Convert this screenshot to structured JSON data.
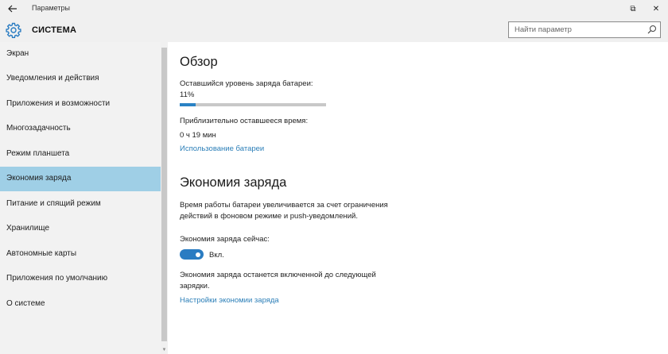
{
  "window": {
    "title": "Параметры",
    "restore_glyph": "⧉",
    "close_glyph": "✕"
  },
  "header": {
    "title": "СИСТЕМА",
    "search_placeholder": "Найти параметр"
  },
  "sidebar": {
    "selected_index": 5,
    "items": [
      {
        "label": "Экран"
      },
      {
        "label": "Уведомления и действия"
      },
      {
        "label": "Приложения и возможности"
      },
      {
        "label": "Многозадачность"
      },
      {
        "label": "Режим планшета"
      },
      {
        "label": "Экономия заряда"
      },
      {
        "label": "Питание и спящий режим"
      },
      {
        "label": "Хранилище"
      },
      {
        "label": "Автономные карты"
      },
      {
        "label": "Приложения по умолчанию"
      },
      {
        "label": "О системе"
      }
    ]
  },
  "overview": {
    "heading": "Обзор",
    "battery_label": "Оставшийся уровень заряда батареи:",
    "battery_value": "11%",
    "battery_fraction": 0.11,
    "time_label": "Приблизительно оставшееся время:",
    "time_value": "0 ч 19 мин",
    "usage_link": "Использование батареи"
  },
  "saver": {
    "heading": "Экономия заряда",
    "description_line1": "Время работы батареи увеличивается за счет ограничения",
    "description_line2": "действий в фоновом режиме и push-уведомлений.",
    "now_label": "Экономия заряда сейчас:",
    "toggle_state": "Вкл.",
    "note_line1": "Экономия заряда останется включенной до следующей",
    "note_line2": "зарядки.",
    "settings_link": "Настройки экономии заряда"
  },
  "colors": {
    "accent": "#2a7cc2",
    "link": "#2c7fb8",
    "selected_bg": "#9fcfe6"
  }
}
